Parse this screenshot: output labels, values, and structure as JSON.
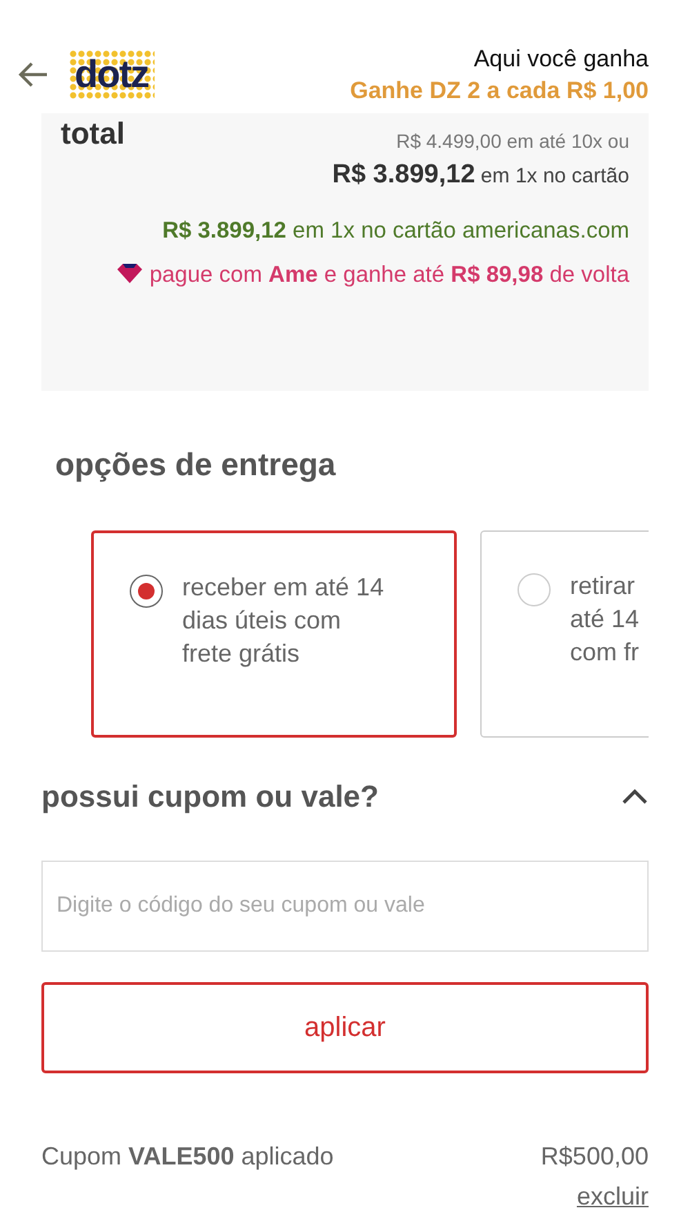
{
  "header": {
    "logo": "dotz",
    "title": "Aqui você ganha",
    "subtitle": "Ganhe DZ 2 a cada  R$ 1,00"
  },
  "total": {
    "label": "total",
    "installments": "R$ 4.499,00 em até 10x ou",
    "price": "**R$ 3.899,12** em 1x no cartão",
    "card_offer": "**R$ 3.899,12** em 1x no cartão americanas.com",
    "ame_offer": "pague com **Ame** e ganhe até **R$ 89,98** de volta"
  },
  "delivery": {
    "title": "opções de entrega",
    "options": [
      {
        "lines": [
          "receber em até 14",
          "dias úteis com",
          "frete grátis"
        ],
        "selected": true
      },
      {
        "lines": [
          "retirar",
          "até 14",
          "com fr"
        ],
        "selected": false
      }
    ]
  },
  "coupon": {
    "title": "possui cupom ou vale?",
    "expanded": true,
    "placeholder": "Digite o código do seu cupom ou vale",
    "button": "aplicar",
    "applied": "Cupom **VALE500** aplicado",
    "amount": "R$500,00",
    "remove": "excluir"
  }
}
